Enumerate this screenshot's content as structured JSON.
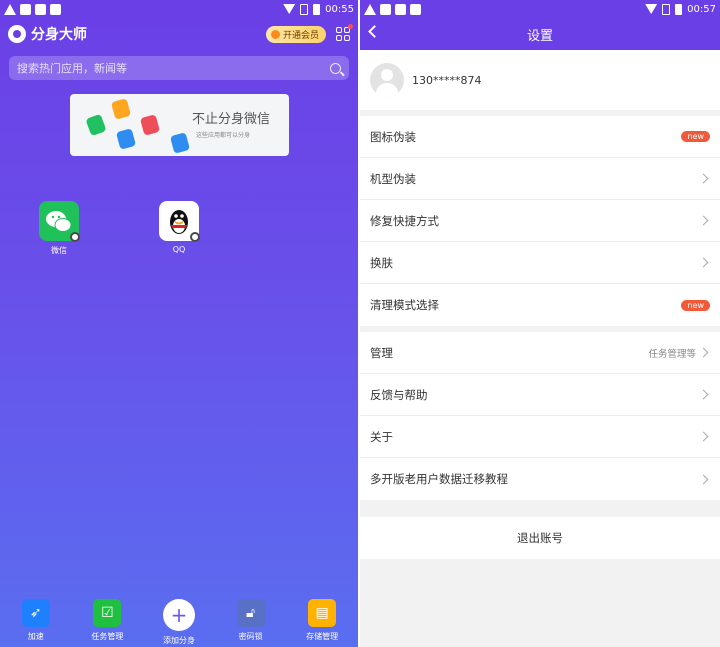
{
  "left": {
    "status": {
      "time": "00:55"
    },
    "header": {
      "app_name": "分身大师",
      "vip_label": "开通会员"
    },
    "search": {
      "placeholder": "搜索热门应用，新闻等"
    },
    "banner": {
      "title": "不止分身微信",
      "subtitle": "这些应用都可以分身"
    },
    "apps": [
      {
        "label": "微信",
        "icon": "wechat-icon"
      },
      {
        "label": "QQ",
        "icon": "qq-penguin-icon"
      }
    ],
    "dock": [
      {
        "label": "加速",
        "icon": "rocket-icon"
      },
      {
        "label": "任务管理",
        "icon": "checkbox-icon"
      },
      {
        "label": "添加分身",
        "icon": "plus-icon"
      },
      {
        "label": "密码锁",
        "icon": "lock-icon"
      },
      {
        "label": "存储管理",
        "icon": "sd-card-icon"
      }
    ]
  },
  "right": {
    "status": {
      "time": "00:57"
    },
    "header": {
      "title": "设置"
    },
    "user": {
      "phone": "130*****874"
    },
    "group1": [
      {
        "label": "图标伪装",
        "badge": "new"
      },
      {
        "label": "机型伪装"
      },
      {
        "label": "修复快捷方式"
      },
      {
        "label": "换肤"
      },
      {
        "label": "清理模式选择",
        "badge": "new"
      }
    ],
    "group2": [
      {
        "label": "管理",
        "extra": "任务管理等"
      },
      {
        "label": "反馈与帮助"
      },
      {
        "label": "关于"
      },
      {
        "label": "多开版老用户数据迁移教程"
      }
    ],
    "logout": "退出账号"
  },
  "colors": {
    "primary": "#6a3fe6",
    "badge": "#f05a3a",
    "wechat": "#20c05b"
  }
}
